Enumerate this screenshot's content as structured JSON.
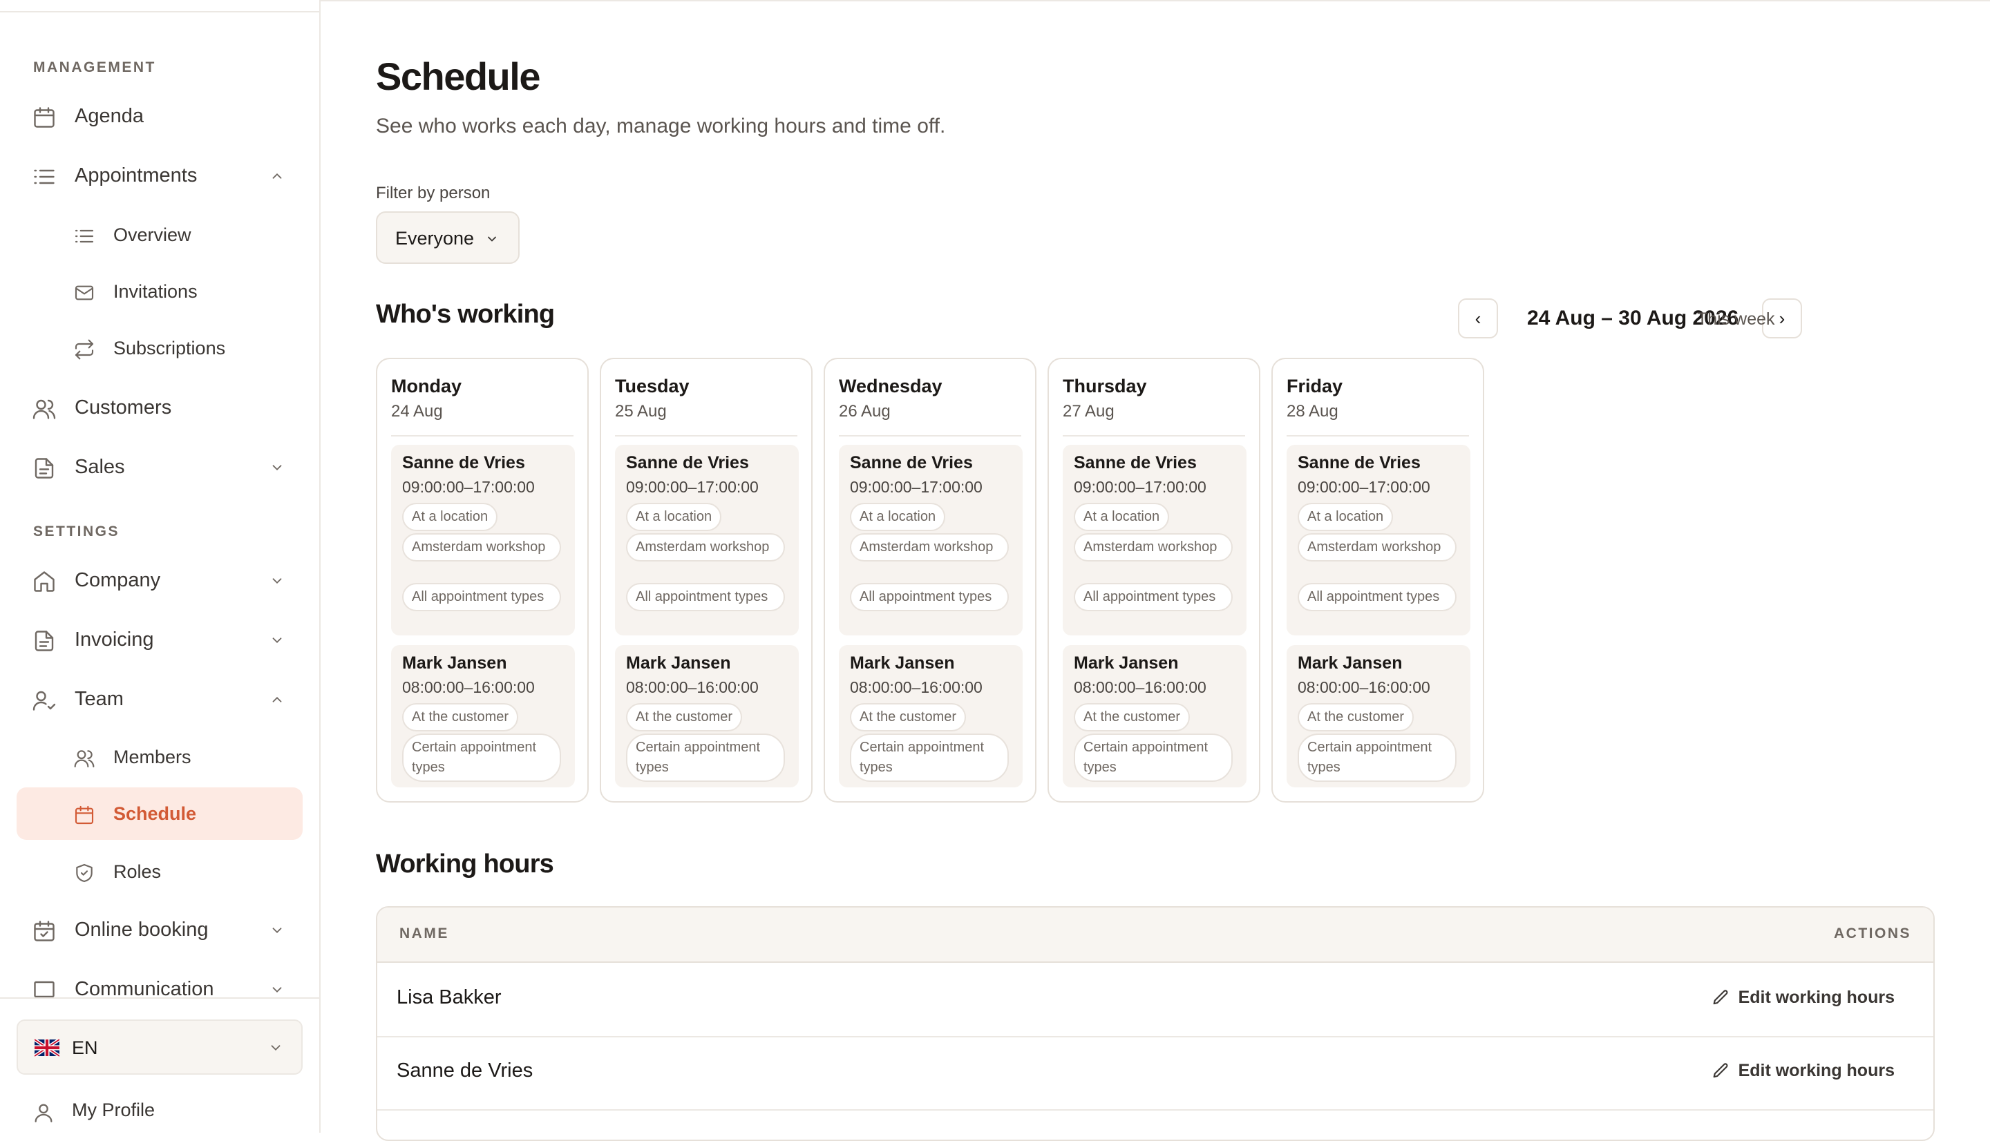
{
  "sidebar": {
    "sections": {
      "management": "MANAGEMENT",
      "settings": "SETTINGS"
    },
    "items": {
      "agenda": "Agenda",
      "appointments": "Appointments",
      "overview": "Overview",
      "invitations": "Invitations",
      "subscriptions": "Subscriptions",
      "customers": "Customers",
      "sales": "Sales",
      "company": "Company",
      "invoicing": "Invoicing",
      "team": "Team",
      "members": "Members",
      "schedule": "Schedule",
      "roles": "Roles",
      "online_booking": "Online booking",
      "communication": "Communication"
    },
    "language": "EN",
    "profile": "My Profile"
  },
  "page": {
    "title": "Schedule",
    "subtitle": "See who works each day, manage working hours and time off.",
    "filter_label": "Filter by person",
    "filter_value": "Everyone"
  },
  "whos_working": {
    "title": "Who's working",
    "prev": "‹",
    "next": "›",
    "range": "24 Aug – 30 Aug 2026",
    "this_week": "This week",
    "days": [
      {
        "name": "Monday",
        "date": "24 Aug",
        "shifts": [
          {
            "person": "Sanne de Vries",
            "time": "09:00:00–17:00:00",
            "tags": [
              "At a location",
              "Amsterdam workshop",
              "All appointment types"
            ]
          },
          {
            "person": "Mark Jansen",
            "time": "08:00:00–16:00:00",
            "tags": [
              "At the customer",
              "Certain appointment types"
            ]
          }
        ]
      },
      {
        "name": "Tuesday",
        "date": "25 Aug",
        "shifts": [
          {
            "person": "Sanne de Vries",
            "time": "09:00:00–17:00:00",
            "tags": [
              "At a location",
              "Amsterdam workshop",
              "All appointment types"
            ]
          },
          {
            "person": "Mark Jansen",
            "time": "08:00:00–16:00:00",
            "tags": [
              "At the customer",
              "Certain appointment types"
            ]
          }
        ]
      },
      {
        "name": "Wednesday",
        "date": "26 Aug",
        "shifts": [
          {
            "person": "Sanne de Vries",
            "time": "09:00:00–17:00:00",
            "tags": [
              "At a location",
              "Amsterdam workshop",
              "All appointment types"
            ]
          },
          {
            "person": "Mark Jansen",
            "time": "08:00:00–16:00:00",
            "tags": [
              "At the customer",
              "Certain appointment types"
            ]
          }
        ]
      },
      {
        "name": "Thursday",
        "date": "27 Aug",
        "shifts": [
          {
            "person": "Sanne de Vries",
            "time": "09:00:00–17:00:00",
            "tags": [
              "At a location",
              "Amsterdam workshop",
              "All appointment types"
            ]
          },
          {
            "person": "Mark Jansen",
            "time": "08:00:00–16:00:00",
            "tags": [
              "At the customer",
              "Certain appointment types"
            ]
          }
        ]
      },
      {
        "name": "Friday",
        "date": "28 Aug",
        "shifts": [
          {
            "person": "Sanne de Vries",
            "time": "09:00:00–17:00:00",
            "tags": [
              "At a location",
              "Amsterdam workshop",
              "All appointment types"
            ]
          },
          {
            "person": "Mark Jansen",
            "time": "08:00:00–16:00:00",
            "tags": [
              "At the customer",
              "Certain appointment types"
            ]
          }
        ]
      }
    ]
  },
  "working_hours": {
    "title": "Working hours",
    "columns": {
      "name": "NAME",
      "actions": "ACTIONS"
    },
    "rows": [
      {
        "name": "Lisa Bakker",
        "action": "Edit working hours"
      },
      {
        "name": "Sanne de Vries",
        "action": "Edit working hours"
      }
    ]
  },
  "colors": {
    "accent": "#d25a35",
    "active_bg": "#fdeae3",
    "card_bg": "#f7f3ef",
    "border": "#e6e0d9"
  }
}
